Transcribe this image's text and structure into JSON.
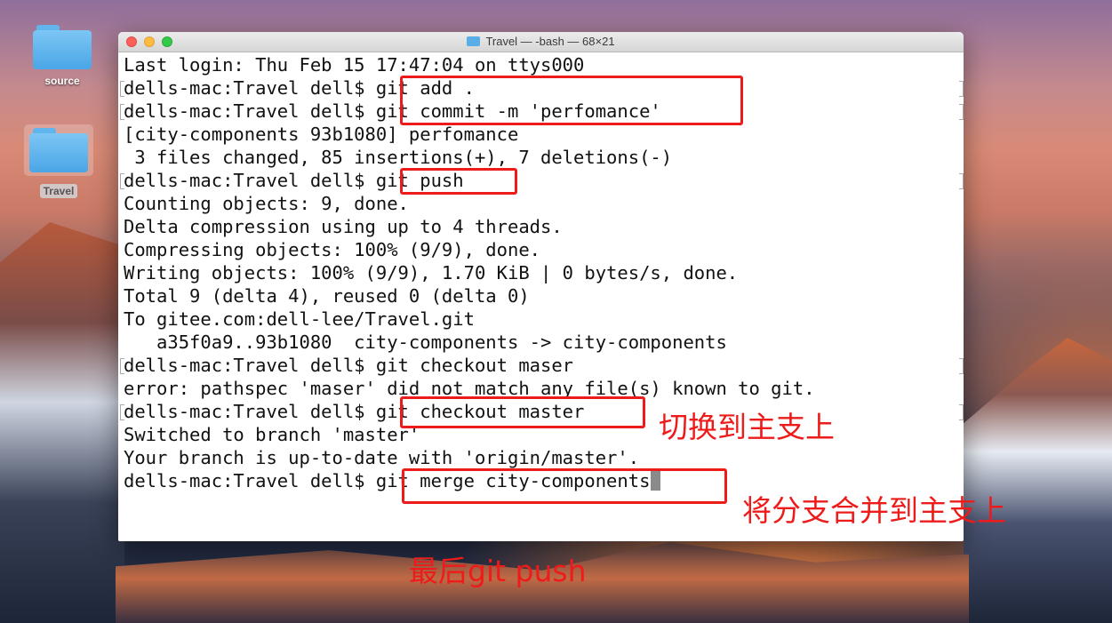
{
  "desktop": {
    "icons": [
      {
        "label": "source"
      },
      {
        "label": "Travel"
      }
    ]
  },
  "window": {
    "title": "Travel — -bash — 68×21",
    "lines": [
      "Last login: Thu Feb 15 17:47:04 on ttys000",
      "dells-mac:Travel dell$ git add .",
      "dells-mac:Travel dell$ git commit -m 'perfomance'",
      "[city-components 93b1080] perfomance",
      " 3 files changed, 85 insertions(+), 7 deletions(-)",
      "dells-mac:Travel dell$ git push",
      "Counting objects: 9, done.",
      "Delta compression using up to 4 threads.",
      "Compressing objects: 100% (9/9), done.",
      "Writing objects: 100% (9/9), 1.70 KiB | 0 bytes/s, done.",
      "Total 9 (delta 4), reused 0 (delta 0)",
      "To gitee.com:dell-lee/Travel.git",
      "   a35f0a9..93b1080  city-components -> city-components",
      "dells-mac:Travel dell$ git checkout maser",
      "error: pathspec 'maser' did not match any file(s) known to git.",
      "dells-mac:Travel dell$ git checkout master",
      "Switched to branch 'master'",
      "Your branch is up-to-date with 'origin/master'.",
      "dells-mac:Travel dell$ git merge city-components"
    ]
  },
  "annotations": {
    "note_checkout": "切换到主支上",
    "note_merge": "将分支合并到主支上",
    "note_push": "最后git push"
  },
  "colors": {
    "annotation": "#ee1b1b",
    "traffic_red": "#fc605b",
    "traffic_yellow": "#fdbc40",
    "traffic_green": "#34c84a"
  }
}
